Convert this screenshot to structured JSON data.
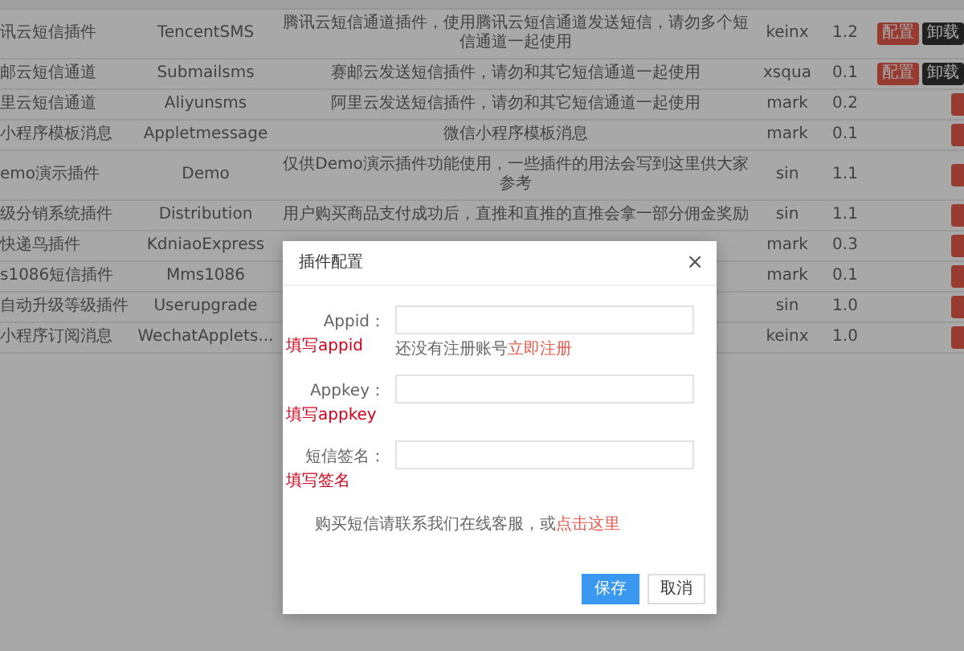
{
  "table": {
    "rows": [
      {
        "name": "讯云短信插件",
        "identifier": "TencentSMS",
        "description": "腾讯云短信通道插件，使用腾讯云短信通道发送短信，请勿多个短信通道一起使用",
        "author": "keinx",
        "version": "1.2",
        "actions": [
          {
            "kind": "configure",
            "label": "配置"
          },
          {
            "kind": "uninstall",
            "label": "卸载"
          }
        ]
      },
      {
        "name": "邮云短信通道",
        "identifier": "Submailsms",
        "description": "赛邮云发送短信插件，请勿和其它短信通道一起使用",
        "author": "xsqua",
        "version": "0.1",
        "actions": [
          {
            "kind": "configure",
            "label": "配置"
          },
          {
            "kind": "uninstall",
            "label": "卸载"
          }
        ]
      },
      {
        "name": "里云短信通道",
        "identifier": "Aliyunsms",
        "description": "阿里云发送短信插件，请勿和其它短信通道一起使用",
        "author": "mark",
        "version": "0.2",
        "actions": [
          {
            "kind": "install"
          }
        ]
      },
      {
        "name": "小程序模板消息",
        "identifier": "Appletmessage",
        "description": "微信小程序模板消息",
        "author": "mark",
        "version": "0.1",
        "actions": [
          {
            "kind": "install"
          }
        ]
      },
      {
        "name": "emo演示插件",
        "identifier": "Demo",
        "description": "仅供Demo演示插件功能使用，一些插件的用法会写到这里供大家参考",
        "author": "sin",
        "version": "1.1",
        "actions": [
          {
            "kind": "install"
          }
        ]
      },
      {
        "name": "级分销系统插件",
        "identifier": "Distribution",
        "description": "用户购买商品支付成功后，直推和直推的直推会拿一部分佣金奖励",
        "author": "sin",
        "version": "1.1",
        "actions": [
          {
            "kind": "install"
          }
        ]
      },
      {
        "name": "快递鸟插件",
        "identifier": "KdniaoExpress",
        "author": "mark",
        "version": "0.3",
        "actions": [
          {
            "kind": "install"
          }
        ]
      },
      {
        "name": "s1086短信插件",
        "identifier": "Mms1086",
        "author": "mark",
        "version": "0.1",
        "actions": [
          {
            "kind": "install"
          }
        ]
      },
      {
        "name": "自动升级等级插件",
        "identifier": "Userupgrade",
        "author": "sin",
        "version": "1.0",
        "actions": [
          {
            "kind": "install"
          }
        ]
      },
      {
        "name": "小程序订阅消息",
        "identifier": "WechatApplets...",
        "author": "keinx",
        "version": "1.0",
        "actions": [
          {
            "kind": "install"
          }
        ]
      }
    ]
  },
  "dialog": {
    "title": "插件配置",
    "close": "×",
    "fields": [
      {
        "label": "Appid：",
        "annotation": "填写appid",
        "help": "还没有注册账号",
        "help_link": "立即注册"
      },
      {
        "label": "Appkey：",
        "annotation": "填写appkey"
      },
      {
        "label": "短信签名：",
        "annotation": "填写签名"
      }
    ],
    "note": "购买短信请联系我们在线客服，或",
    "note_link": "点击这里",
    "buttons": [
      {
        "label": "保存",
        "kind": "primary"
      },
      {
        "label": "取消",
        "kind": "default"
      }
    ]
  }
}
